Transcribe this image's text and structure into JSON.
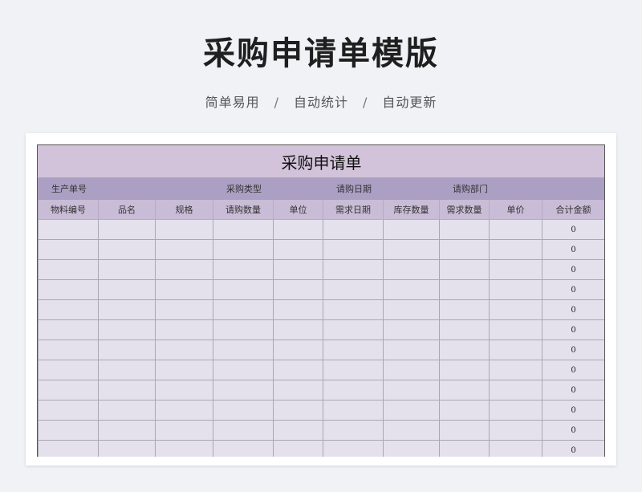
{
  "header": {
    "title": "采购申请单模版",
    "tags": [
      "简单易用",
      "自动统计",
      "自动更新"
    ],
    "separator": "/"
  },
  "form": {
    "title": "采购申请单",
    "meta": {
      "order_no_label": "生产单号",
      "purchase_type_label": "采购类型",
      "request_date_label": "请购日期",
      "request_dept_label": "请购部门"
    },
    "columns": [
      "物料编号",
      "品名",
      "规格",
      "请购数量",
      "单位",
      "需求日期",
      "库存数量",
      "需求数量",
      "单价",
      "合计金额"
    ],
    "rows": [
      [
        "",
        "",
        "",
        "",
        "",
        "",
        "",
        "",
        "",
        "0"
      ],
      [
        "",
        "",
        "",
        "",
        "",
        "",
        "",
        "",
        "",
        "0"
      ],
      [
        "",
        "",
        "",
        "",
        "",
        "",
        "",
        "",
        "",
        "0"
      ],
      [
        "",
        "",
        "",
        "",
        "",
        "",
        "",
        "",
        "",
        "0"
      ],
      [
        "",
        "",
        "",
        "",
        "",
        "",
        "",
        "",
        "",
        "0"
      ],
      [
        "",
        "",
        "",
        "",
        "",
        "",
        "",
        "",
        "",
        "0"
      ],
      [
        "",
        "",
        "",
        "",
        "",
        "",
        "",
        "",
        "",
        "0"
      ],
      [
        "",
        "",
        "",
        "",
        "",
        "",
        "",
        "",
        "",
        "0"
      ],
      [
        "",
        "",
        "",
        "",
        "",
        "",
        "",
        "",
        "",
        "0"
      ],
      [
        "",
        "",
        "",
        "",
        "",
        "",
        "",
        "",
        "",
        "0"
      ],
      [
        "",
        "",
        "",
        "",
        "",
        "",
        "",
        "",
        "",
        "0"
      ],
      [
        "",
        "",
        "",
        "",
        "",
        "",
        "",
        "",
        "",
        "0"
      ]
    ]
  }
}
